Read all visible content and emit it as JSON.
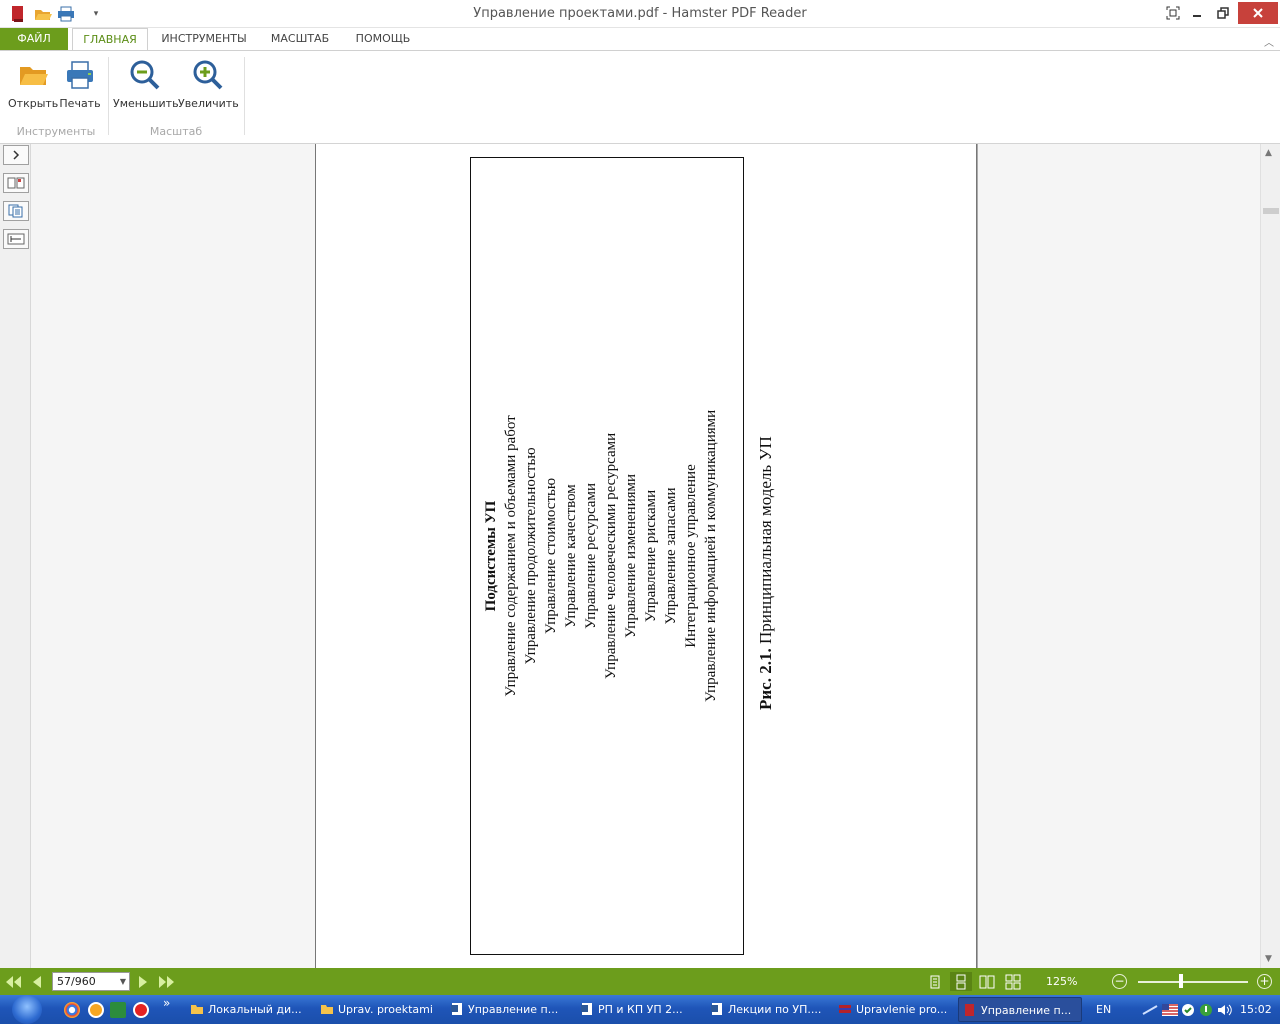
{
  "window": {
    "title": "Управление проектами.pdf - Hamster PDF Reader"
  },
  "ribbon_tabs": {
    "file": "ФАЙЛ",
    "home": "ГЛАВНАЯ",
    "tools": "ИНСТРУМЕНТЫ",
    "zoom": "МАСШТАБ",
    "help": "ПОМОЩЬ"
  },
  "ribbon": {
    "open": "Открыть",
    "print": "Печать",
    "zoom_out": "Уменьшить",
    "zoom_in": "Увеличить",
    "group_tools": "Инструменты",
    "group_zoom": "Масштаб"
  },
  "document": {
    "heading": "Подсистемы УП",
    "items": [
      "Управление содержанием и объемами работ",
      "Управление продолжительностью",
      "Управление стоимостью",
      "Управление качеством",
      "Управление ресурсами",
      "Управление человеческими ресурсами",
      "Управление изменениями",
      "Управление рисками",
      "Управление запасами",
      "Интеграционное управление",
      "Управление информацией и коммуникациями"
    ],
    "caption_label": "Рис. 2.1.",
    "caption_text": "Принципиальная модель УП"
  },
  "statusbar": {
    "page": "57/960",
    "zoom": "125%"
  },
  "taskbar": {
    "tasks": [
      "Локальный ди...",
      "Uprav. proektami",
      "Управление п...",
      "РП и КП  УП 2...",
      "Лекции по УП....",
      "Upravlenie pro...",
      "Управление п..."
    ],
    "lang": "EN",
    "time": "15:02",
    "more": "»"
  },
  "colors": {
    "accent": "#6c9d1c",
    "close": "#c7413b",
    "taskbar": "#1f55b8"
  }
}
